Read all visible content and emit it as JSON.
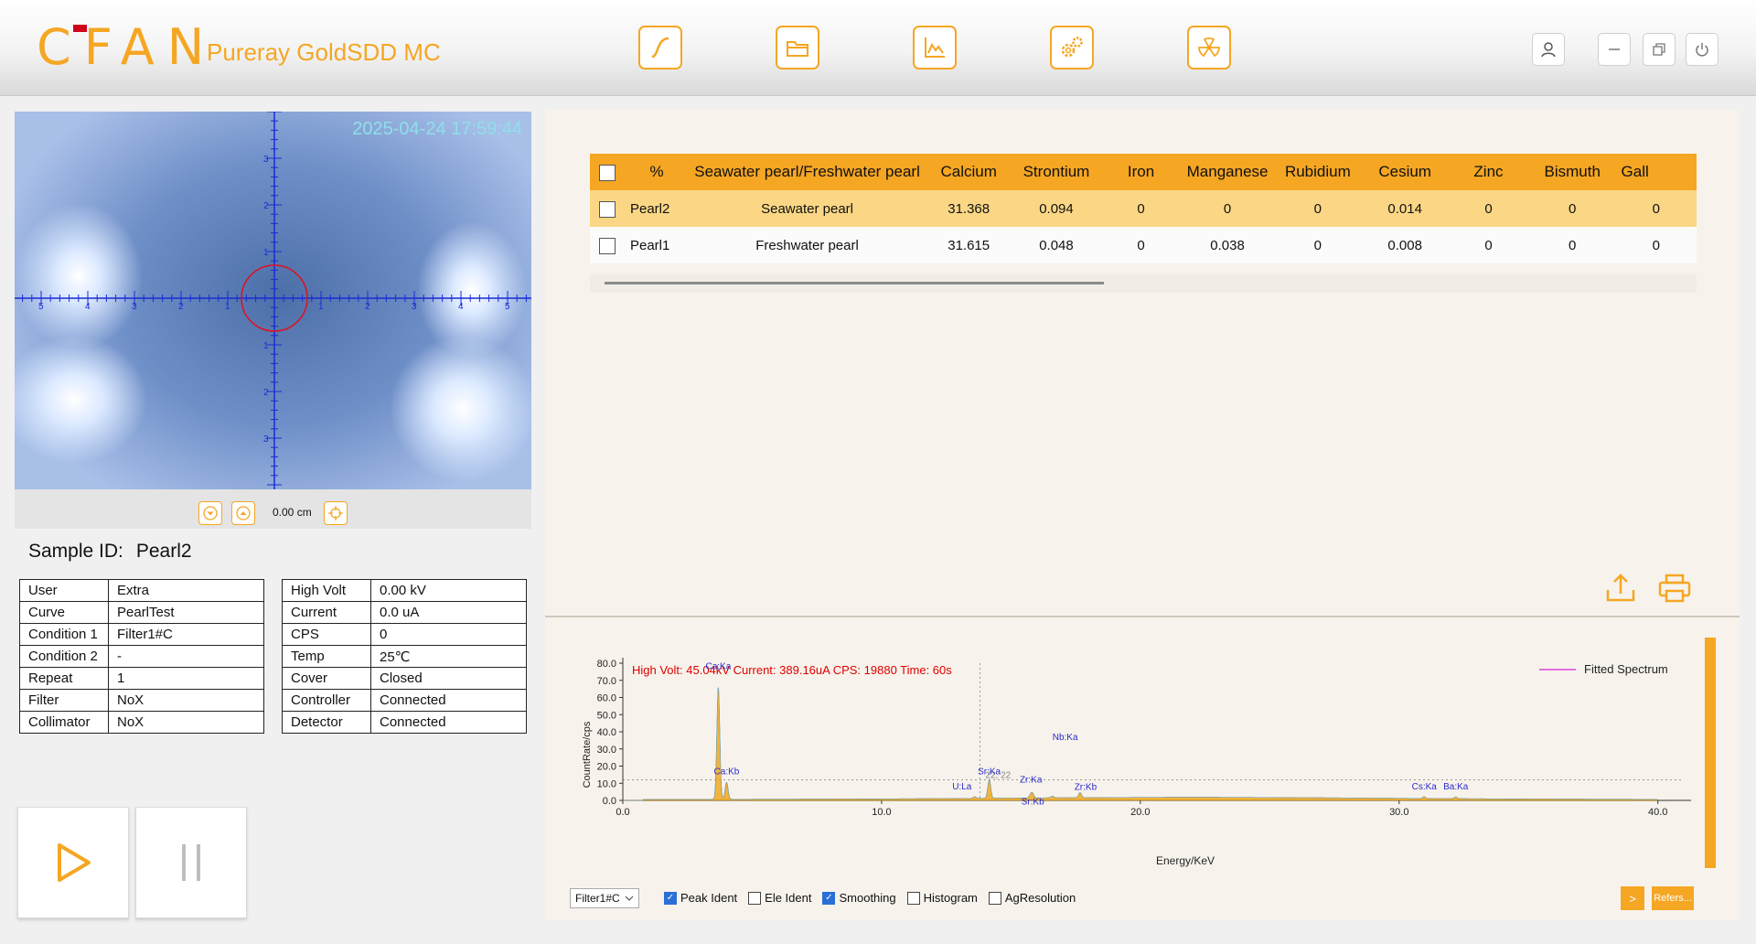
{
  "header": {
    "logo": "CFAN",
    "product": "Pureray GoldSDD MC",
    "nav_icons": [
      "curve-icon",
      "folder-icon",
      "spectrum-icon",
      "settings-icon",
      "radiation-icon"
    ],
    "window_icons": [
      "user-icon",
      "minimize-icon",
      "restore-icon",
      "power-icon"
    ]
  },
  "camera": {
    "timestamp": "2025-04-24 17:59:44",
    "x_ticks": [
      "5",
      "4",
      "3",
      "2",
      "1",
      "1",
      "2",
      "3",
      "4",
      "5"
    ],
    "y_ticks": [
      "3",
      "2",
      "1",
      "1",
      "2",
      "3"
    ],
    "distance": "0.00 cm"
  },
  "sample": {
    "label": "Sample ID:",
    "value": "Pearl2"
  },
  "info_left": [
    [
      "User",
      "Extra"
    ],
    [
      "Curve",
      "PearlTest"
    ],
    [
      "Condition 1",
      "Filter1#C"
    ],
    [
      "Condition 2",
      "-"
    ],
    [
      "Repeat",
      "1"
    ],
    [
      "Filter",
      "NoX"
    ],
    [
      "Collimator",
      "NoX"
    ]
  ],
  "info_right": [
    [
      "High Volt",
      "0.00 kV"
    ],
    [
      "Current",
      "0.0 uA"
    ],
    [
      "CPS",
      "0"
    ],
    [
      "Temp",
      "25℃"
    ],
    [
      "Cover",
      "Closed"
    ],
    [
      "Controller",
      "Connected"
    ],
    [
      "Detector",
      "Connected"
    ]
  ],
  "results": {
    "headers": [
      "%",
      "Seawater pearl/Freshwater pearl",
      "Calcium",
      "Strontium",
      "Iron",
      "Manganese",
      "Rubidium",
      "Cesium",
      "Zinc",
      "Bismuth",
      "Gall"
    ],
    "rows": [
      {
        "name": "Pearl2",
        "type": "Seawater pearl",
        "values": [
          "31.368",
          "0.094",
          "0",
          "0",
          "0",
          "0.014",
          "0",
          "0",
          "0"
        ]
      },
      {
        "name": "Pearl1",
        "type": "Freshwater pearl",
        "values": [
          "31.615",
          "0.048",
          "0",
          "0.038",
          "0",
          "0.008",
          "0",
          "0",
          "0"
        ]
      }
    ]
  },
  "chart_data": {
    "type": "line",
    "title": "High Volt: 45.04kV  Current: 389.16uA  CPS: 19880  Time: 60s",
    "xlabel": "Energy/KeV",
    "ylabel": "CountRate/cps",
    "xlim": [
      0,
      41
    ],
    "ylim": [
      0,
      80
    ],
    "xticks": [
      "0.0",
      "10.0",
      "20.0",
      "30.0",
      "40.0"
    ],
    "yticks": [
      "0.0",
      "10.0",
      "20.0",
      "30.0",
      "40.0",
      "50.0",
      "60.0",
      "70.0",
      "80.0"
    ],
    "legend": [
      "Fitted Spectrum"
    ],
    "legend_position": "top-right",
    "peaks": [
      {
        "label": "Ca:Ka",
        "x": 3.69,
        "y": 66
      },
      {
        "label": "Ca:Kb",
        "x": 4.01,
        "y": 10
      },
      {
        "label": "U:La",
        "x": 13.6,
        "y": 1
      },
      {
        "label": "Sr:Ka",
        "x": 14.16,
        "y": 11
      },
      {
        "label": "Zr:Ka",
        "x": 15.77,
        "y": 2
      },
      {
        "label": "Nb:Ka",
        "x": 16.6,
        "y": 1
      },
      {
        "label": "Sr:Kb",
        "x": 15.84,
        "y": 2
      },
      {
        "label": "Zr:Kb",
        "x": 17.67,
        "y": 3
      },
      {
        "label": "Cs:Ka",
        "x": 30.97,
        "y": 1
      },
      {
        "label": "Ba:Ka",
        "x": 32.19,
        "y": 1
      }
    ],
    "cursor_x": 13.8,
    "cursor_y": 12,
    "cursor_readout": "22, 22",
    "series_color": "#f0a820",
    "legend_color": "#e040e0"
  },
  "options": {
    "filter_select": "Filter1#C",
    "checks": [
      {
        "label": "Peak Ident",
        "on": true
      },
      {
        "label": "Ele Ident",
        "on": false
      },
      {
        "label": "Smoothing",
        "on": true
      },
      {
        "label": "Histogram",
        "on": false
      },
      {
        "label": "AgResolution",
        "on": false
      }
    ],
    "next_label": ">",
    "refers_label": "Refers..."
  }
}
